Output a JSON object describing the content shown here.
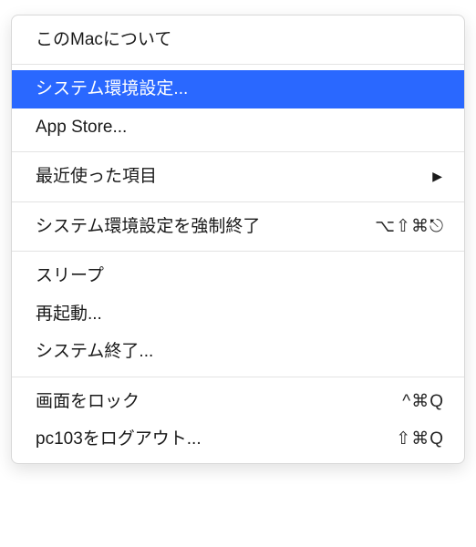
{
  "menu": {
    "items": [
      {
        "label": "このMacについて",
        "shortcut": "",
        "submenu": false
      },
      {
        "sep": true
      },
      {
        "label": "システム環境設定...",
        "shortcut": "",
        "submenu": false,
        "highlight": true
      },
      {
        "label": "App Store...",
        "shortcut": "",
        "submenu": false
      },
      {
        "sep": true
      },
      {
        "label": "最近使った項目",
        "shortcut": "",
        "submenu": true
      },
      {
        "sep": true
      },
      {
        "label": "システム環境設定を強制終了",
        "shortcut": "⌥⇧⌘⎋",
        "submenu": false
      },
      {
        "sep": true
      },
      {
        "label": "スリープ",
        "shortcut": "",
        "submenu": false
      },
      {
        "label": "再起動...",
        "shortcut": "",
        "submenu": false
      },
      {
        "label": "システム終了...",
        "shortcut": "",
        "submenu": false
      },
      {
        "sep": true
      },
      {
        "label": "画面をロック",
        "shortcut": "^⌘Q",
        "submenu": false
      },
      {
        "label": "pc103をログアウト...",
        "shortcut": "⇧⌘Q",
        "submenu": false
      }
    ]
  },
  "colors": {
    "highlight": "#2a68ff"
  }
}
